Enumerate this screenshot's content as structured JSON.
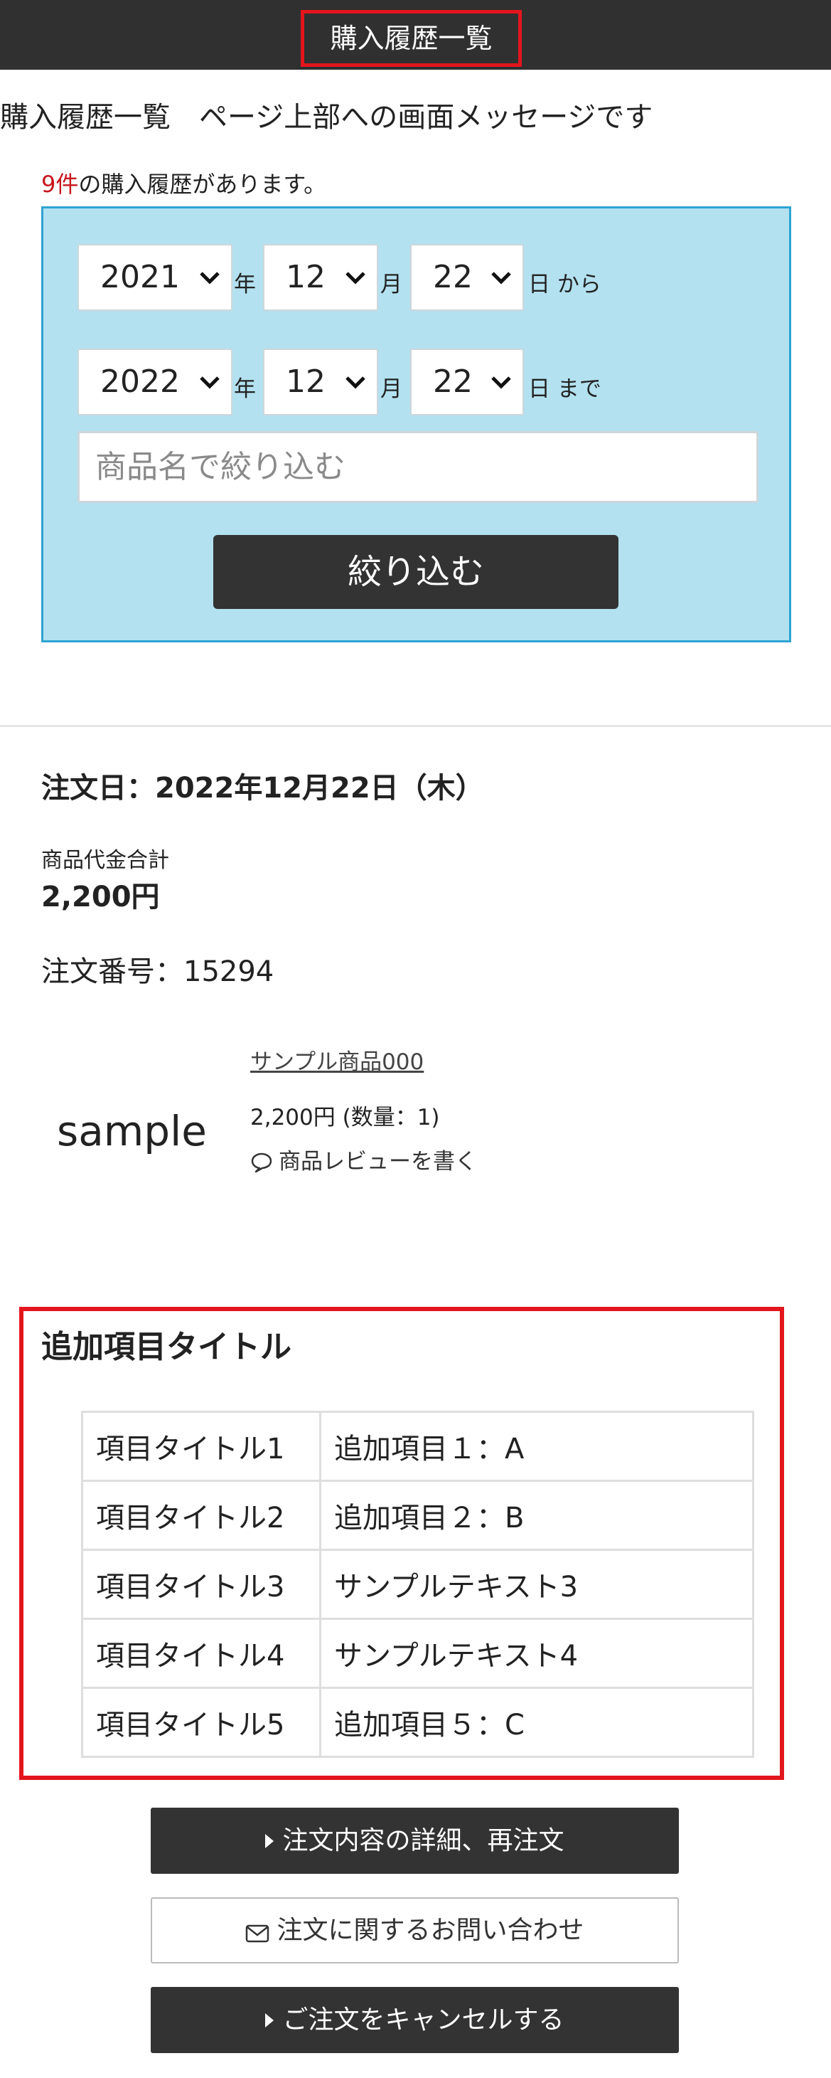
{
  "header": {
    "title": "購入履歴一覧"
  },
  "page_message": "購入履歴一覧　ページ上部への画面メッセージです",
  "summary": {
    "count": "9件",
    "count_suffix": "の購入履歴があります。"
  },
  "filter": {
    "from": {
      "year": "2021",
      "month": "12",
      "day": "22",
      "suffix": "から"
    },
    "to": {
      "year": "2022",
      "month": "12",
      "day": "22",
      "suffix": "まで"
    },
    "unit_year": "年",
    "unit_month": "月",
    "unit_day": "日",
    "search_placeholder": "商品名で絞り込む",
    "submit_label": "絞り込む"
  },
  "order": {
    "date": "注文日：2022年12月22日（木）",
    "total_label": "商品代金合計",
    "total_value": "2,200円",
    "order_number": "注文番号：15294",
    "item": {
      "image_text": "sample",
      "name": "サンプル商品000",
      "price_qty": "2,200円 (数量：1)",
      "review_label": "商品レビューを書く"
    }
  },
  "extra": {
    "title": "追加項目タイトル",
    "rows": [
      {
        "key": "項目タイトル1",
        "value": "追加項目１：A"
      },
      {
        "key": "項目タイトル2",
        "value": "追加項目２：B"
      },
      {
        "key": "項目タイトル3",
        "value": "サンプルテキスト3"
      },
      {
        "key": "項目タイトル4",
        "value": "サンプルテキスト4"
      },
      {
        "key": "項目タイトル5",
        "value": "追加項目５：C"
      }
    ]
  },
  "actions": {
    "details_label": "注文内容の詳細、再注文",
    "inquiry_label": "注文に関するお問い合わせ",
    "cancel_label": "ご注文をキャンセルする"
  },
  "colors": {
    "accent_red": "#e3151d",
    "dark": "#333333",
    "filter_bg": "#b3e1f0",
    "filter_border": "#2ea3d3"
  }
}
